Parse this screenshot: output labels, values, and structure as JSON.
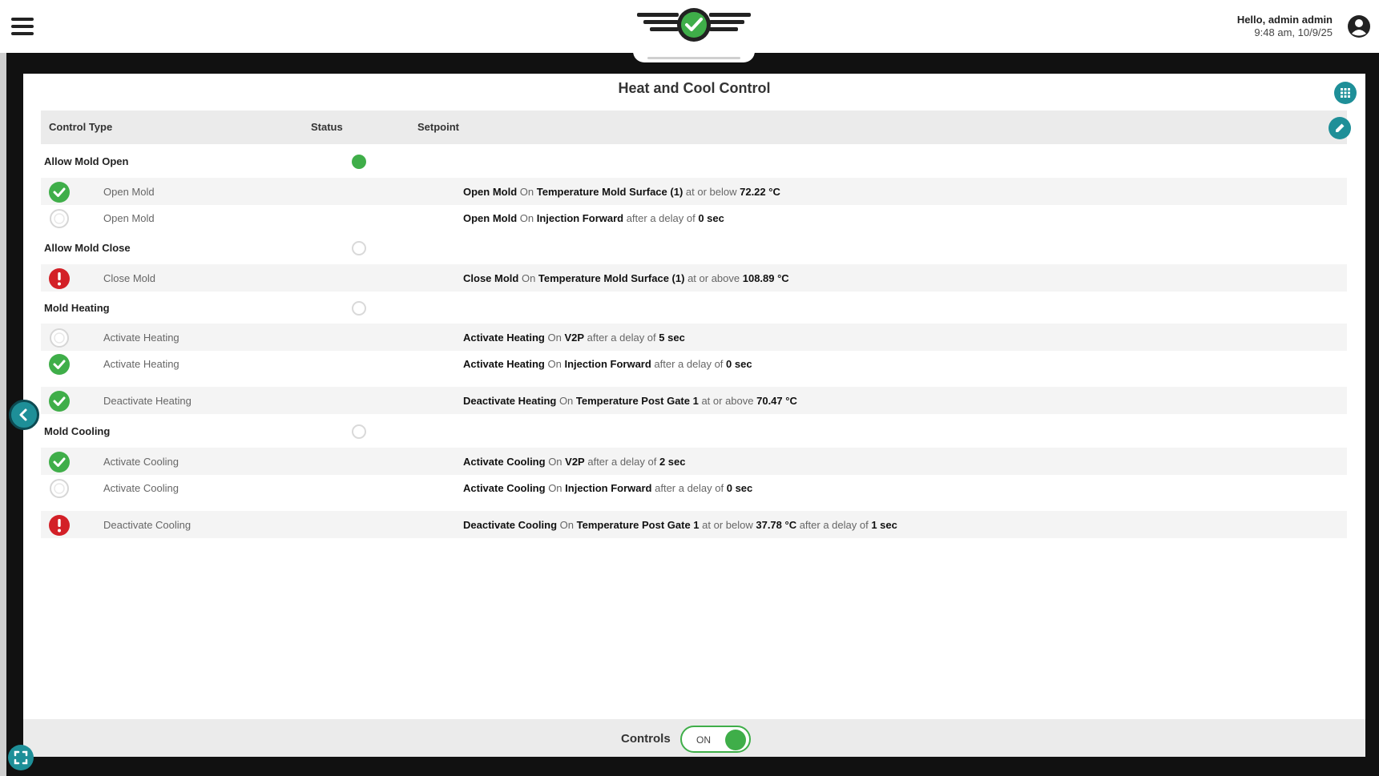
{
  "header": {
    "greeting": "Hello, admin admin",
    "datetime": "9:48 am, 10/9/25"
  },
  "colors": {
    "accent": "#1e8f98",
    "ok": "#3fae49",
    "error": "#d32027",
    "frame": "#111111"
  },
  "panel": {
    "title": "Heat and Cool Control",
    "columns": [
      "Control Type",
      "Status",
      "Setpoint"
    ]
  },
  "groups": [
    {
      "label": "Allow Mold Open",
      "status": "on",
      "rows": [
        {
          "icon": "check-icon",
          "label": "Open Mold",
          "setpoint": [
            [
              "b",
              "Open Mold"
            ],
            [
              "m",
              " On "
            ],
            [
              "b",
              "Temperature Mold Surface (1)"
            ],
            [
              "m",
              " at or below "
            ],
            [
              "b",
              "72.22 °C"
            ]
          ]
        },
        {
          "icon": "pending-icon",
          "label": "Open Mold",
          "setpoint": [
            [
              "b",
              "Open Mold"
            ],
            [
              "m",
              " On "
            ],
            [
              "b",
              "Injection Forward"
            ],
            [
              "m",
              " after a delay of "
            ],
            [
              "b",
              "0 sec"
            ]
          ]
        }
      ]
    },
    {
      "label": "Allow Mold Close",
      "status": "off",
      "rows": [
        {
          "icon": "alert-icon",
          "label": "Close Mold",
          "setpoint": [
            [
              "b",
              "Close Mold"
            ],
            [
              "m",
              " On "
            ],
            [
              "b",
              "Temperature Mold Surface (1)"
            ],
            [
              "m",
              " at or above "
            ],
            [
              "b",
              "108.89 °C"
            ]
          ]
        }
      ]
    },
    {
      "label": "Mold Heating",
      "status": "off",
      "rows": [
        {
          "icon": "pending-icon",
          "label": "Activate Heating",
          "setpoint": [
            [
              "b",
              "Activate Heating"
            ],
            [
              "m",
              " On "
            ],
            [
              "b",
              "V2P"
            ],
            [
              "m",
              " after a delay of "
            ],
            [
              "b",
              "5 sec"
            ]
          ]
        },
        {
          "icon": "check-icon",
          "label": "Activate Heating",
          "setpoint": [
            [
              "b",
              "Activate Heating"
            ],
            [
              "m",
              " On "
            ],
            [
              "b",
              "Injection Forward"
            ],
            [
              "m",
              " after a delay of "
            ],
            [
              "b",
              "0 sec"
            ]
          ]
        },
        {
          "icon": "check-icon",
          "label": "Deactivate Heating",
          "setpoint": [
            [
              "b",
              "Deactivate Heating"
            ],
            [
              "m",
              " On "
            ],
            [
              "b",
              "Temperature Post Gate 1"
            ],
            [
              "m",
              " at or above "
            ],
            [
              "b",
              "70.47 °C"
            ]
          ]
        }
      ]
    },
    {
      "label": "Mold Cooling",
      "status": "off",
      "rows": [
        {
          "icon": "check-icon",
          "label": "Activate Cooling",
          "setpoint": [
            [
              "b",
              "Activate Cooling"
            ],
            [
              "m",
              " On "
            ],
            [
              "b",
              "V2P"
            ],
            [
              "m",
              " after a delay of "
            ],
            [
              "b",
              "2 sec"
            ]
          ]
        },
        {
          "icon": "pending-icon",
          "label": "Activate Cooling",
          "setpoint": [
            [
              "b",
              "Activate Cooling"
            ],
            [
              "m",
              " On "
            ],
            [
              "b",
              "Injection Forward"
            ],
            [
              "m",
              " after a delay of "
            ],
            [
              "b",
              "0 sec"
            ]
          ]
        },
        {
          "icon": "alert-icon",
          "label": "Deactivate Cooling",
          "setpoint": [
            [
              "b",
              "Deactivate Cooling"
            ],
            [
              "m",
              " On "
            ],
            [
              "b",
              "Temperature Post Gate 1"
            ],
            [
              "m",
              " at or below "
            ],
            [
              "b",
              "37.78 °C"
            ],
            [
              "m",
              " after a delay of "
            ],
            [
              "b",
              "1 sec"
            ]
          ]
        }
      ]
    }
  ],
  "footer": {
    "controls_label": "Controls",
    "toggle_text": "ON",
    "toggle_state": true
  }
}
